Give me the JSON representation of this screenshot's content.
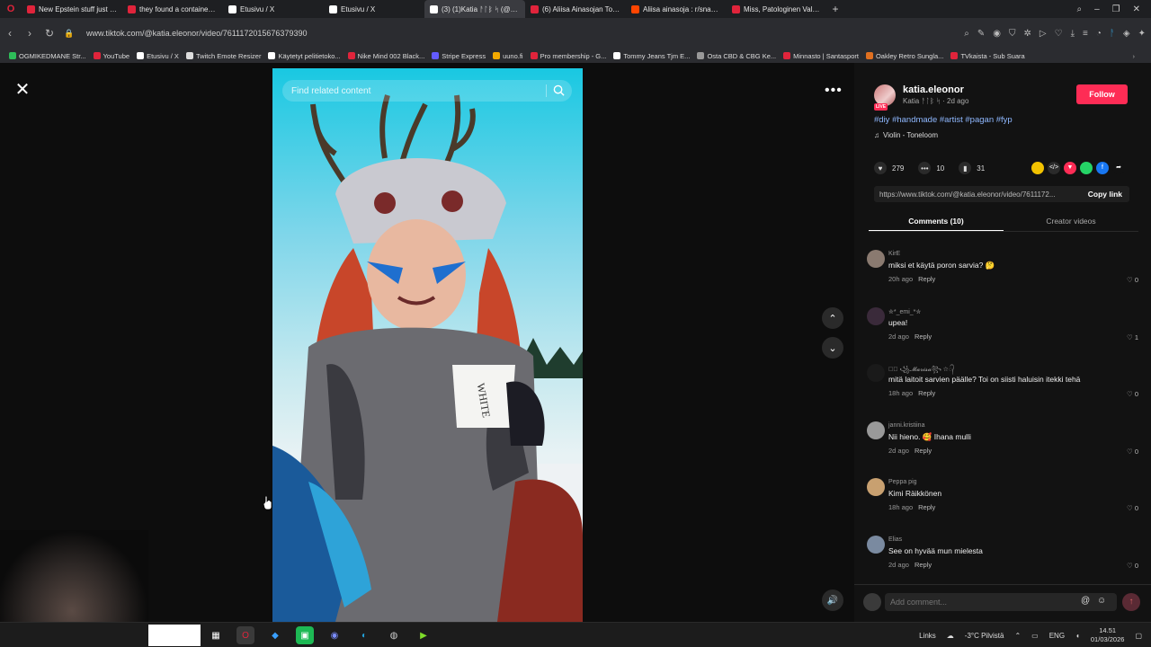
{
  "browser": {
    "tabs": [
      {
        "label": "New Epstein stuff just dro",
        "color": "#e0243b"
      },
      {
        "label": "they found a container fill",
        "color": "#e0243b"
      },
      {
        "label": "Etusivu / X",
        "color": "#ffffff"
      },
      {
        "label": "Etusivu / X",
        "color": "#ffffff"
      },
      {
        "label": "(3) (1)Katia ᚨᛚᛒ ᛋ (@kati",
        "color": "#ffffff",
        "active": true
      },
      {
        "label": "(6) Aliisa Ainasojan Toilail",
        "color": "#e0243b"
      },
      {
        "label": "Aliisa ainasoja : r/snappise",
        "color": "#ff4500"
      },
      {
        "label": "Miss, Patologinen Valehte",
        "color": "#e0243b"
      }
    ],
    "new_tab": "+",
    "url": "www.tiktok.com/@katia.eleonor/video/7611172015676379390",
    "bookmarks": [
      {
        "label": "OGMIKEDMANE Str...",
        "color": "#2ebd59"
      },
      {
        "label": "YouTube",
        "color": "#e0243b"
      },
      {
        "label": "Etusivu / X",
        "color": "#ffffff"
      },
      {
        "label": "Twitch Emote Resizer",
        "color": "#dddddd"
      },
      {
        "label": "Käytetyt pelitietoko...",
        "color": "#ffffff"
      },
      {
        "label": "Nike Mind 002 Black...",
        "color": "#e0243b"
      },
      {
        "label": "Stripe Express",
        "color": "#635bff"
      },
      {
        "label": "uuno.fi",
        "color": "#f2a900"
      },
      {
        "label": "Pro membership - G...",
        "color": "#e0243b"
      },
      {
        "label": "Tommy Jeans Tjm E...",
        "color": "#ffffff"
      },
      {
        "label": "Osta CBD & CBG Ke...",
        "color": "#999999"
      },
      {
        "label": "Minnasto | Santasport",
        "color": "#e0243b"
      },
      {
        "label": "Oakley Retro Sungla...",
        "color": "#e07020"
      },
      {
        "label": "TVkaista - Sub Suara",
        "color": "#e0243b"
      }
    ]
  },
  "video": {
    "search_placeholder": "Find related content"
  },
  "post": {
    "username": "katia.eleonor",
    "meta": "Katia ᚨᛚᛒ ᛋ · 2d ago",
    "live": "LIVE",
    "follow": "Follow",
    "hashtags": "#diy #handmade #artist #pagan #fyp",
    "music": "Violin - Toneloom",
    "likes": "279",
    "comments_count": "10",
    "saves": "31",
    "link": "https://www.tiktok.com/@katia.eleonor/video/7611172...",
    "copy_link": "Copy link",
    "tab_comments": "Comments (10)",
    "tab_creator": "Creator videos"
  },
  "comments": [
    {
      "user": "KirE",
      "text": "miksi et käytä poron sarvia? 🤔",
      "time": "20h ago",
      "likes": "0",
      "avatar": "#8a7a70"
    },
    {
      "user": "✮*_emi_*✮",
      "text": "upea!",
      "time": "2d ago",
      "likes": "1",
      "avatar": "#3a2a3a"
    },
    {
      "user": "☆᭄ ꧁𝓜𝓪𝓻𝓲𝓼𝓪꧂ ☆᭄",
      "text": "mitä laitoit sarvien päälle? Toi on siisti haluisin itekki tehä",
      "time": "18h ago",
      "likes": "0",
      "avatar": "#1a1a1a"
    },
    {
      "user": "janni.kristiina",
      "text": "Nii hieno. 🥰 Ihana mulli",
      "time": "2d ago",
      "likes": "0",
      "avatar": "#999999"
    },
    {
      "user": "Peppa pig",
      "text": "Kimi Räikkönen",
      "time": "18h ago",
      "likes": "0",
      "avatar": "#c8a070"
    },
    {
      "user": "Elias",
      "text": "See on hyvää mun mielesta",
      "time": "2d ago",
      "likes": "0",
      "avatar": "#7a8aa0"
    }
  ],
  "reply_label": "Reply",
  "comment_input": {
    "placeholder": "Add comment..."
  },
  "taskbar": {
    "links": "Links",
    "weather": "-3°C Pilvistä",
    "lang": "ENG",
    "time": "14.51",
    "date": "01/03/2026"
  }
}
